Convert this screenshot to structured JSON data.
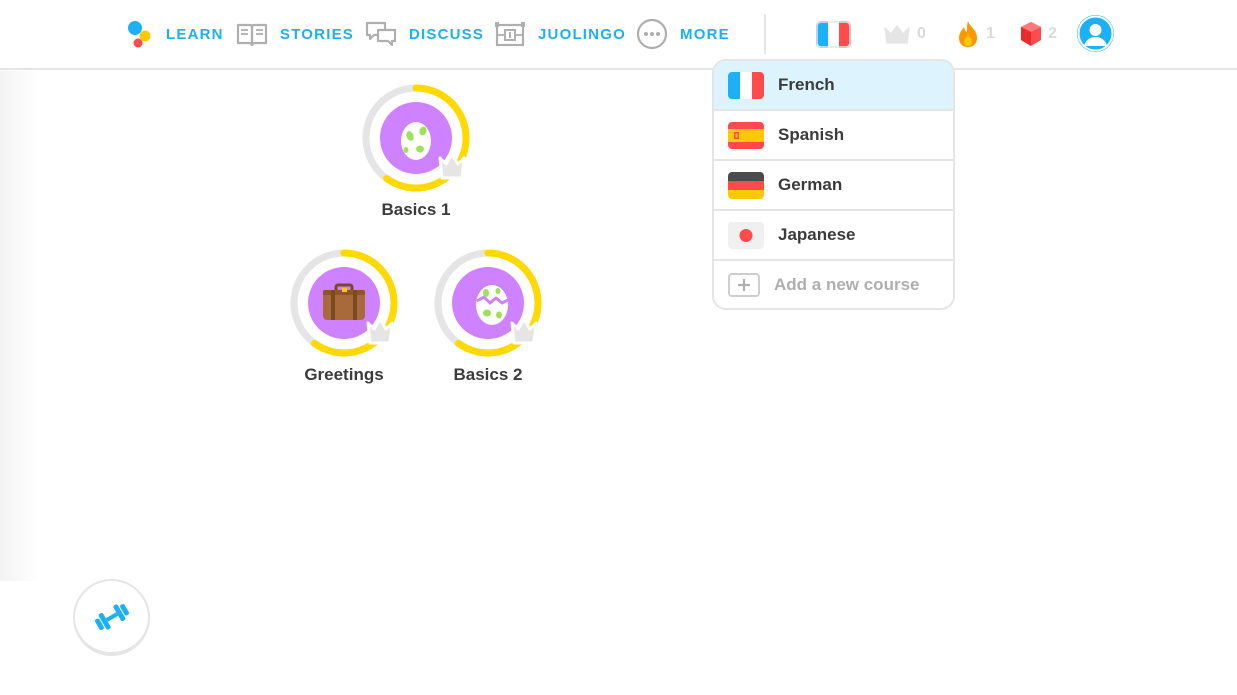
{
  "nav": {
    "learn": "LEARN",
    "stories": "STORIES",
    "discuss": "DISCUSS",
    "juolingo": "JUOLINGO",
    "more": "MORE"
  },
  "stats": {
    "crowns": "0",
    "streak": "1",
    "gems": "2"
  },
  "current_course_icon": "france-flag-icon",
  "skills": [
    {
      "name": "Basics 1",
      "icon": "egg-icon",
      "progress": 0.6
    },
    {
      "name": "Greetings",
      "icon": "suitcase-icon",
      "progress": 0.6
    },
    {
      "name": "Basics 2",
      "icon": "hatching-egg-icon",
      "progress": 0.6
    }
  ],
  "dropdown": {
    "courses": [
      {
        "name": "French",
        "flag": "france-flag-icon",
        "selected": true
      },
      {
        "name": "Spanish",
        "flag": "spain-flag-icon",
        "selected": false
      },
      {
        "name": "German",
        "flag": "germany-flag-icon",
        "selected": false
      },
      {
        "name": "Japanese",
        "flag": "japan-flag-icon",
        "selected": false
      }
    ],
    "add_course": "Add a new course"
  },
  "colors": {
    "accent_blue": "#1cb0f6",
    "progress_gold": "#ffd900",
    "skill_purple": "#ce82ff",
    "selected_row": "#ddf4ff"
  }
}
